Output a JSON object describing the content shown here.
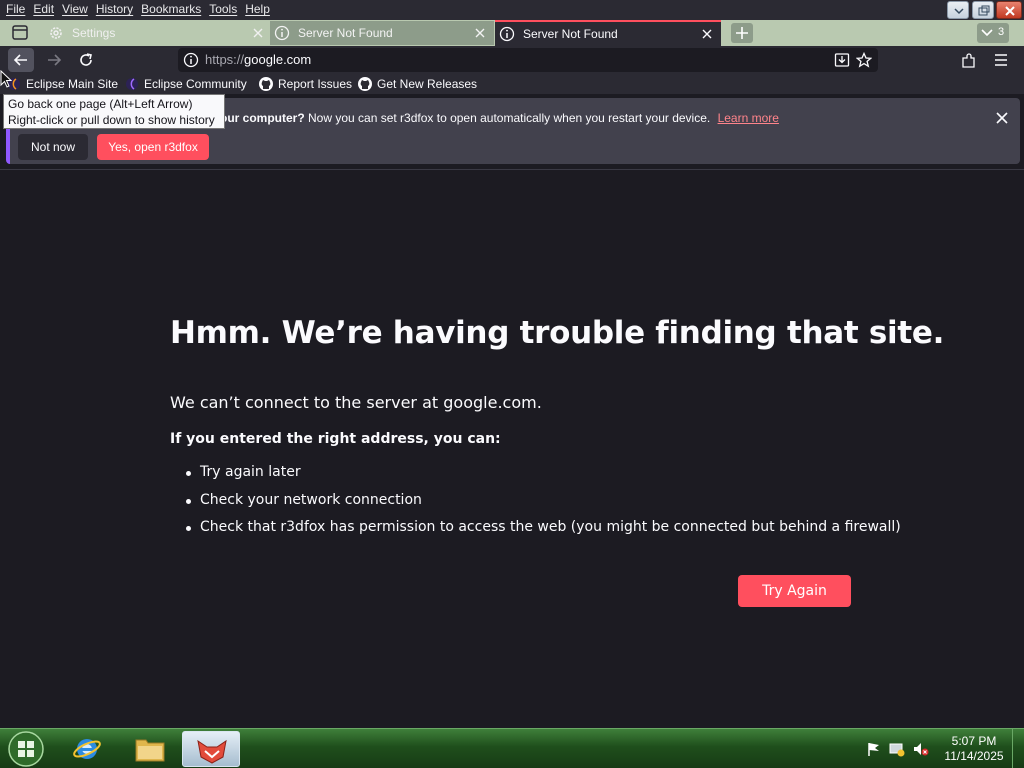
{
  "menubar": {
    "items": [
      "File",
      "Edit",
      "View",
      "History",
      "Bookmarks",
      "Tools",
      "Help"
    ]
  },
  "tabs": [
    {
      "label": "Settings",
      "icon": "gear-icon",
      "state": "inactive"
    },
    {
      "label": "Server Not Found",
      "icon": "info-icon",
      "state": "inactive"
    },
    {
      "label": "Server Not Found",
      "icon": "info-icon",
      "state": "active"
    }
  ],
  "tab_count": "3",
  "navbar": {
    "url_scheme": "https://",
    "url_host": "google.com"
  },
  "bookmarks": [
    {
      "label": "Eclipse Main Site",
      "icon": "eclipse-icon"
    },
    {
      "label": "Eclipse Community",
      "icon": "eclipse-icon"
    },
    {
      "label": "Report Issues",
      "icon": "github-icon"
    },
    {
      "label": "Get New Releases",
      "icon": "github-icon"
    }
  ],
  "notification": {
    "bold_text": "our computer?",
    "text": " Now you can set r3dfox to open automatically when you restart your device.",
    "learn_more": "Learn more",
    "not_now": "Not now",
    "yes_open": "Yes, open r3dfox"
  },
  "tooltip": {
    "line1": "Go back one page (Alt+Left Arrow)",
    "line2": "Right-click or pull down to show history"
  },
  "error_page": {
    "title": "Hmm. We’re having trouble finding that site.",
    "message": "We can’t connect to the server at google.com.",
    "subheading": "If you entered the right address, you can:",
    "suggestions": [
      "Try again later",
      "Check your network connection",
      "Check that r3dfox has permission to access the web (you might be connected but behind a firewall)"
    ],
    "try_again": "Try Again"
  },
  "taskbar": {
    "time": "5:07 PM",
    "date": "11/14/2025"
  },
  "colors": {
    "accent": "#ff4f5e",
    "page_background": "#1c1b22",
    "toolbar": "#2b2a33",
    "notification_bar": "#42414d"
  }
}
